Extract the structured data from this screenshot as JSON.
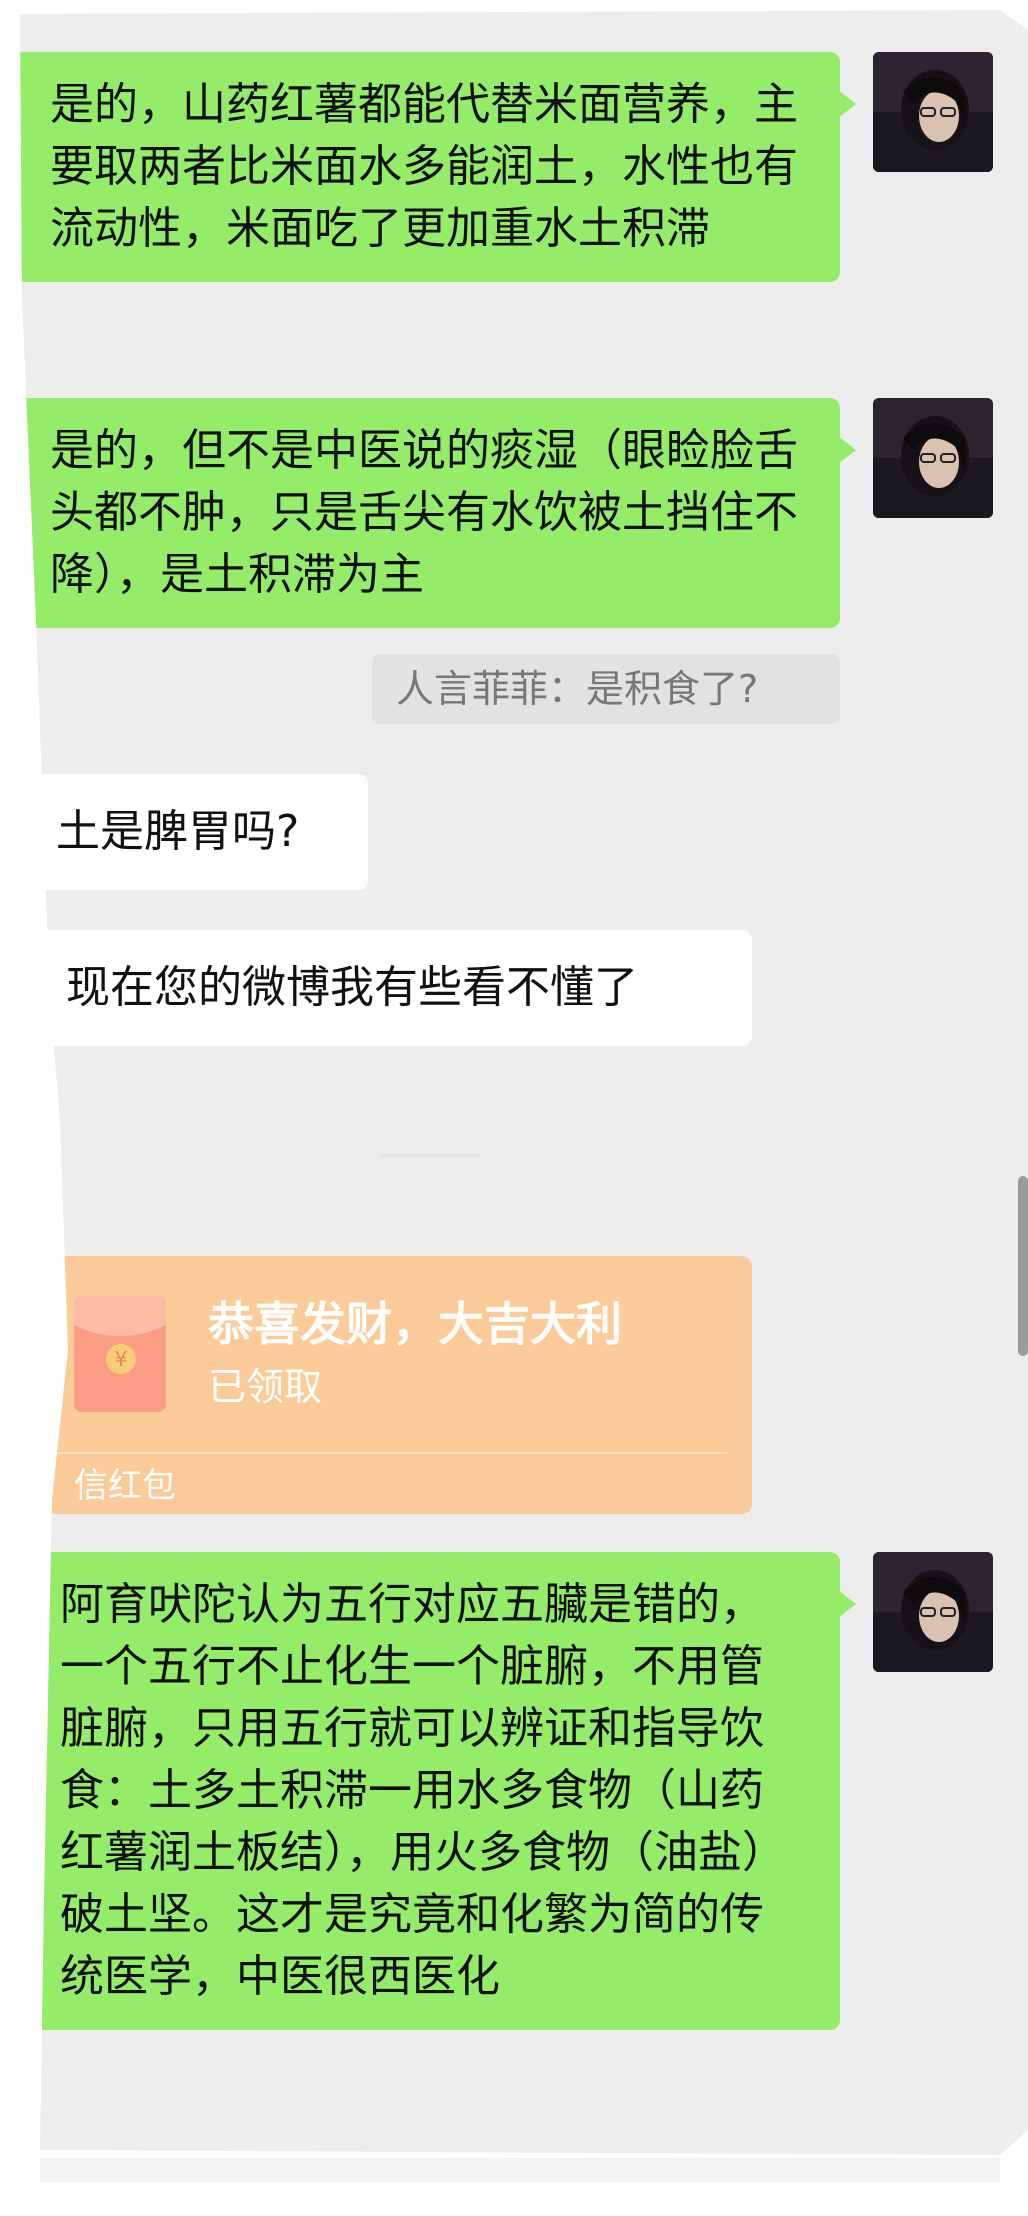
{
  "messages": [
    {
      "side": "outgoing",
      "text": "是的，山药红薯都能代替米面营养，主要取两者比米面水多能润土，水性也有流动性，米面吃了更加重水土积滞"
    },
    {
      "side": "outgoing",
      "text": "是的，但不是中医说的痰湿（眼睑脸舌头都不肿，只是舌尖有水饮被土挡住不降），是土积滞为主"
    },
    {
      "side": "quote",
      "text": "人言菲菲：是积食了?"
    },
    {
      "side": "incoming",
      "text": "土是脾胃吗?"
    },
    {
      "side": "incoming",
      "text": "现在您的微博我有些看不懂了"
    },
    {
      "side": "outgoing",
      "text": "阿育吠陀认为五行对应五臟是错的，一个五行不止化生一个脏腑，不用管脏腑，只用五行就可以辨证和指导饮食：土多土积滞一用水多食物（山药红薯润土板结），用火多食物（油盐）破土坚。这才是究竟和化繁为简的传统医学，中医很西医化"
    }
  ],
  "red_packet": {
    "title": "恭喜发财，大吉大利",
    "status": "已领取",
    "label": "信红包",
    "coin_symbol": "¥"
  },
  "colors": {
    "outgoing_bubble": "#95ec69",
    "incoming_bubble": "#ffffff",
    "red_packet": "#fbcb9a",
    "chat_background": "#ededed"
  },
  "icons": [
    "avatar",
    "red-packet-icon",
    "coin-icon"
  ]
}
